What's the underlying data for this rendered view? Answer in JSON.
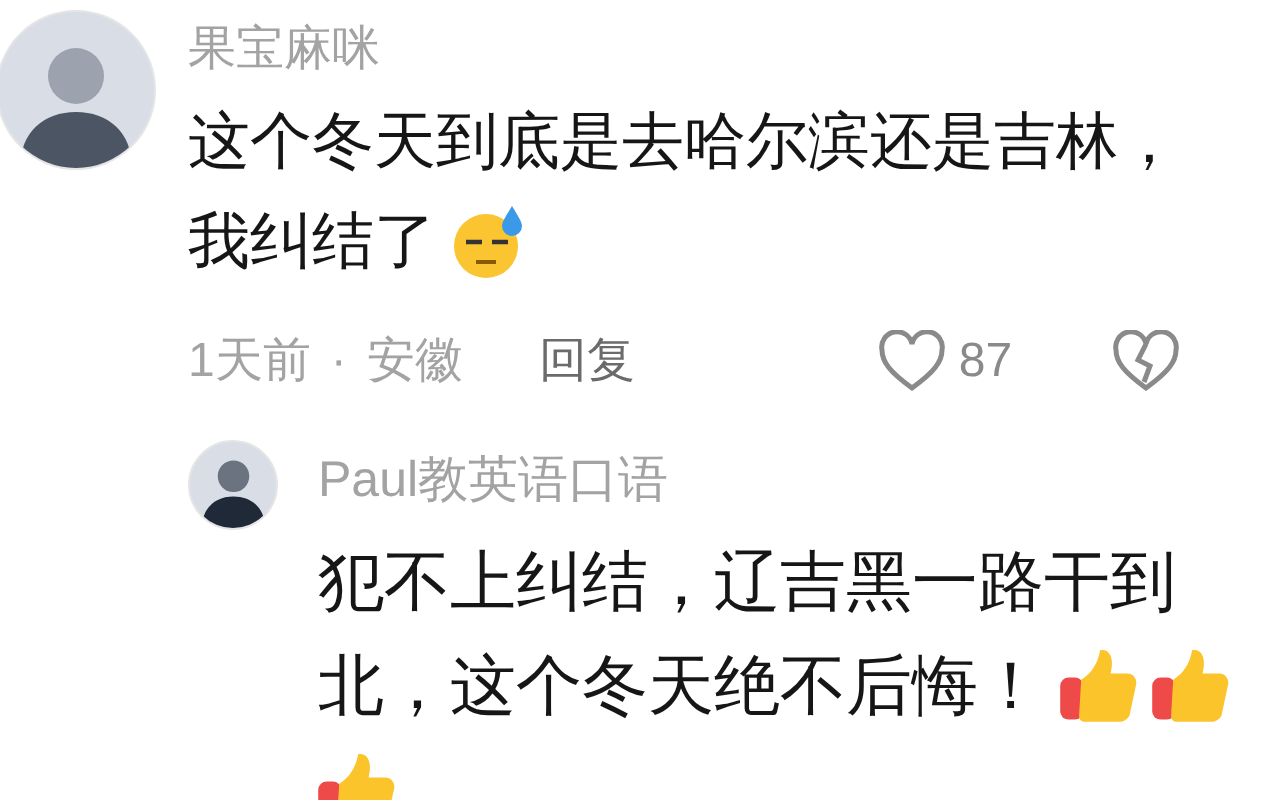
{
  "comments": [
    {
      "author": "果宝麻咪",
      "text_lines": [
        "这个冬天到底是去哈尔滨还是吉林，",
        "我纠结了"
      ],
      "emojis": [
        {
          "kind": "sweat"
        }
      ],
      "time": "1天前",
      "separator": "·",
      "location": "安徽",
      "reply_label": "回复",
      "like_count": "87",
      "replies": [
        {
          "author": "Paul教英语口语",
          "text_lines": [
            "犯不上纠结，辽吉黑一路干到",
            "北，这个冬天绝不后悔！"
          ],
          "emojis": [
            {
              "kind": "thumbs_up"
            },
            {
              "kind": "thumbs_up"
            },
            {
              "kind": "thumbs_up"
            }
          ]
        }
      ]
    }
  ]
}
